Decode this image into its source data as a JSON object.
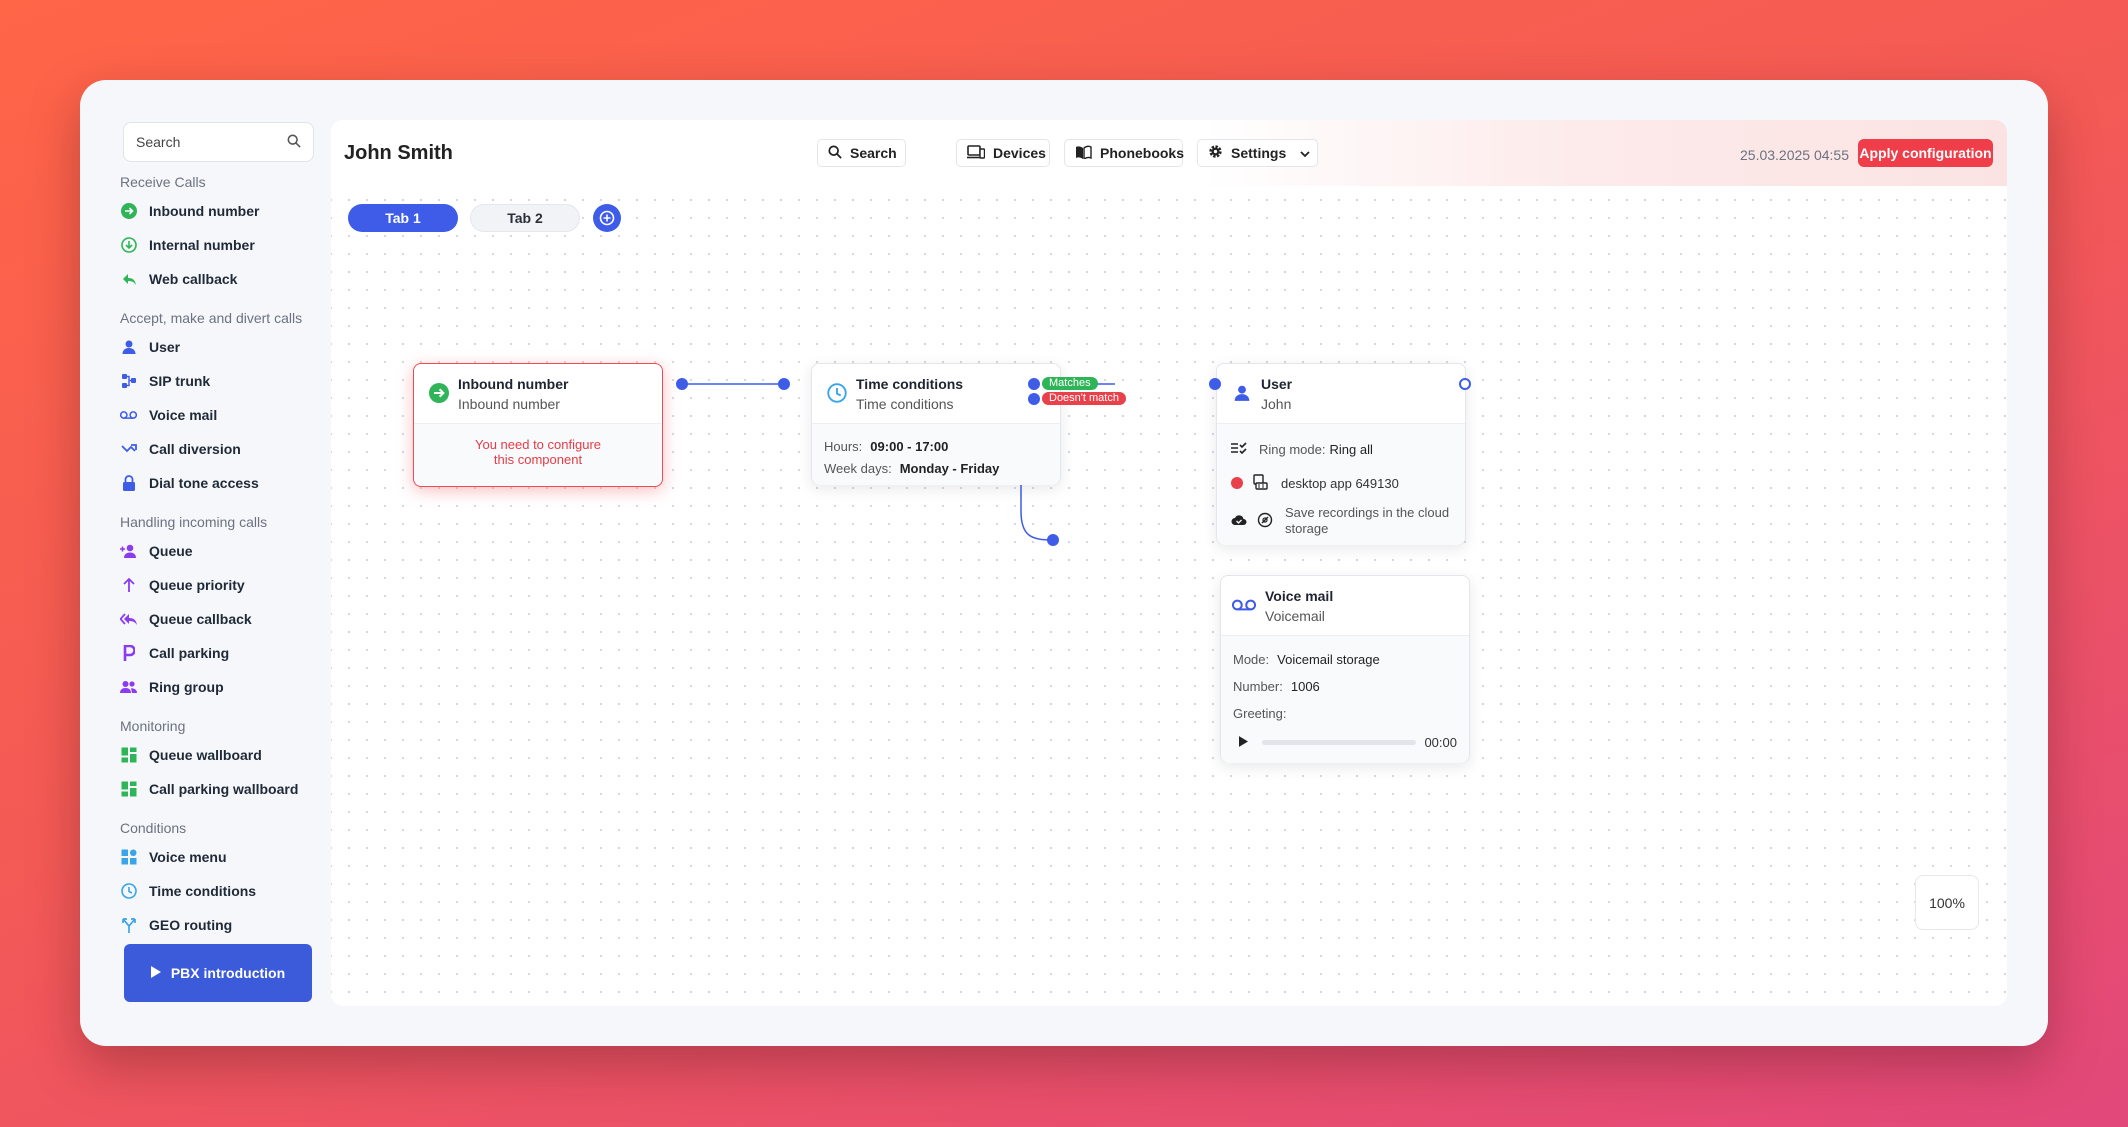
{
  "sidebar": {
    "search_placeholder": "Search",
    "sections": [
      {
        "title": "Receive Calls",
        "items": [
          {
            "label": "Inbound number",
            "icon": "arrow-circle-icon"
          },
          {
            "label": "Internal number",
            "icon": "download-circle-icon"
          },
          {
            "label": "Web callback",
            "icon": "reply-icon"
          }
        ]
      },
      {
        "title": "Accept, make and divert calls",
        "items": [
          {
            "label": "User",
            "icon": "user-icon"
          },
          {
            "label": "SIP trunk",
            "icon": "sip-trunk-icon"
          },
          {
            "label": "Voice mail",
            "icon": "voicemail-icon"
          },
          {
            "label": "Call diversion",
            "icon": "diversion-icon"
          },
          {
            "label": "Dial tone access",
            "icon": "lock-icon"
          }
        ]
      },
      {
        "title": "Handling incoming calls",
        "items": [
          {
            "label": "Queue",
            "icon": "queue-icon"
          },
          {
            "label": "Queue priority",
            "icon": "arrow-up-icon"
          },
          {
            "label": "Queue callback",
            "icon": "reply-all-icon"
          },
          {
            "label": "Call parking",
            "icon": "parking-icon"
          },
          {
            "label": "Ring group",
            "icon": "group-icon"
          }
        ]
      },
      {
        "title": "Monitoring",
        "items": [
          {
            "label": "Queue wallboard",
            "icon": "dashboard-icon"
          },
          {
            "label": "Call parking wallboard",
            "icon": "dashboard-icon"
          }
        ]
      },
      {
        "title": "Conditions",
        "items": [
          {
            "label": "Voice menu",
            "icon": "menu-grid-icon"
          },
          {
            "label": "Time conditions",
            "icon": "clock-icon"
          },
          {
            "label": "GEO routing",
            "icon": "routing-icon"
          }
        ]
      }
    ],
    "pbx_button": "PBX introduction"
  },
  "header": {
    "title": "John Smith",
    "search": "Search",
    "devices": "Devices",
    "phonebooks": "Phonebooks",
    "settings": "Settings",
    "date": "25.03.2025 04:55",
    "apply": "Apply configuration"
  },
  "tabs": [
    "Tab 1",
    "Tab 2"
  ],
  "zoom": "100%",
  "nodes": {
    "inbound": {
      "title": "Inbound number",
      "subtitle": "Inbound number",
      "error": "You need to configure this component"
    },
    "time": {
      "title": "Time conditions",
      "subtitle": "Time conditions",
      "hours_label": "Hours:",
      "hours": "09:00 - 17:00",
      "days_label": "Week days:",
      "days": "Monday - Friday",
      "match": "Matches",
      "nomatch": "Doesn't match"
    },
    "user": {
      "title": "User",
      "subtitle": "John",
      "ring_label": "Ring mode:",
      "ring_value": "Ring all",
      "device": "desktop app 649130",
      "recordings": "Save recordings in the cloud storage"
    },
    "voicemail": {
      "title": "Voice mail",
      "subtitle": "Voicemail",
      "mode_label": "Mode:",
      "mode": "Voicemail storage",
      "number_label": "Number:",
      "number": "1006",
      "greeting_label": "Greeting:",
      "time": "00:00"
    }
  },
  "colors": {
    "accent": "#3e5ce8",
    "danger": "#ef3e4a",
    "success": "#2fb457"
  }
}
